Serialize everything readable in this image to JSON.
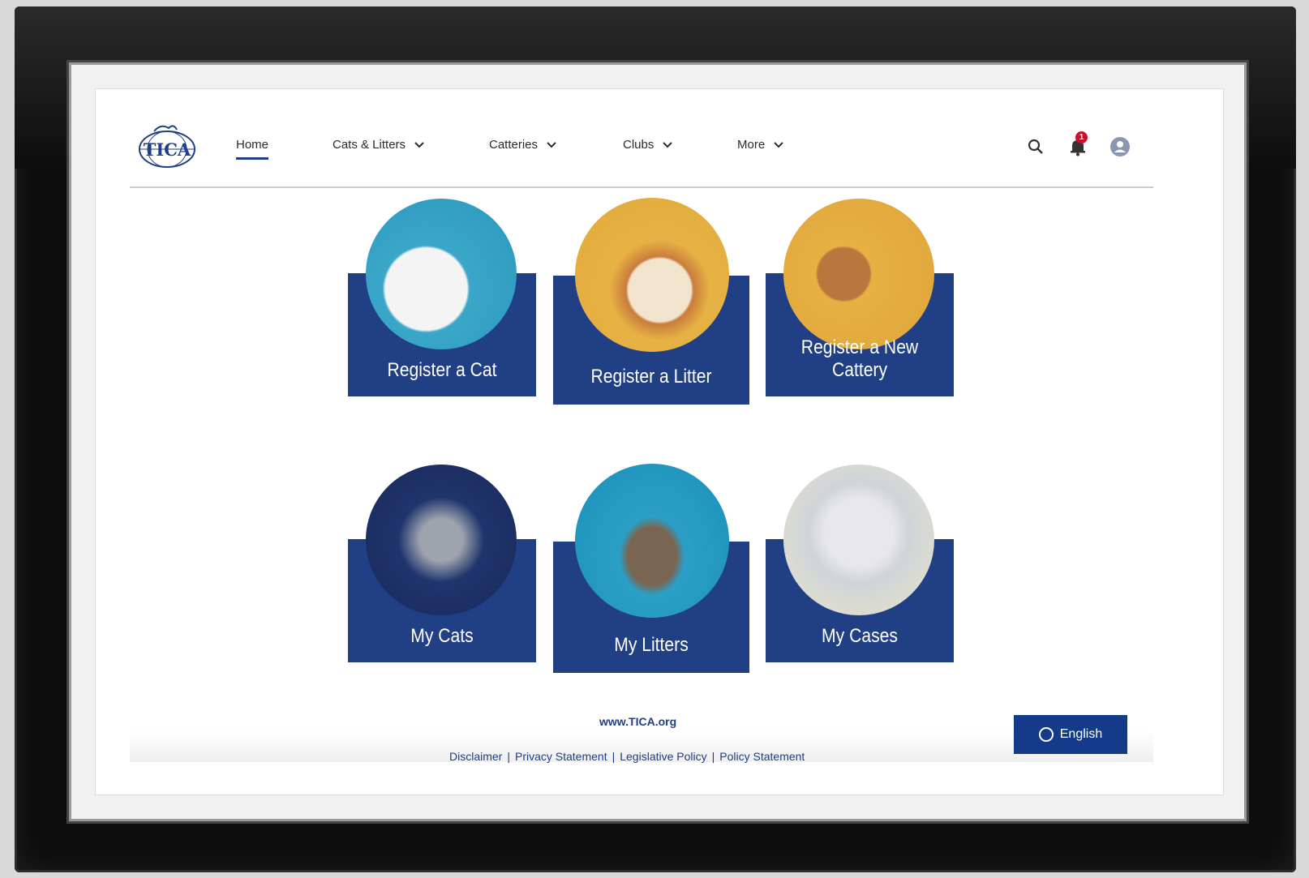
{
  "nav": {
    "items": [
      {
        "label": "Home",
        "active": true
      },
      {
        "label": "Cats & Litters",
        "dropdown": true
      },
      {
        "label": "Catteries",
        "dropdown": true
      },
      {
        "label": "Clubs",
        "dropdown": true
      },
      {
        "label": "More",
        "dropdown": true
      }
    ]
  },
  "header": {
    "logo_text": "TICA",
    "notification_count": "1",
    "icons": [
      "search-icon",
      "bell-icon",
      "user-avatar-icon"
    ]
  },
  "tiles": [
    {
      "label": "Register a Cat"
    },
    {
      "label": "Register a Litter"
    },
    {
      "label": "Register a New Cattery"
    },
    {
      "label": "My Cats"
    },
    {
      "label": "My Litters"
    },
    {
      "label": "My Cases"
    }
  ],
  "footer": {
    "site_link": "www.TICA.org",
    "links": [
      "Disclaimer",
      "Privacy Statement",
      "Legislative Policy",
      "Policy Statement"
    ]
  },
  "language": {
    "label": "English"
  },
  "colors": {
    "brand_blue": "#213f85",
    "badge_red": "#c8102e"
  }
}
